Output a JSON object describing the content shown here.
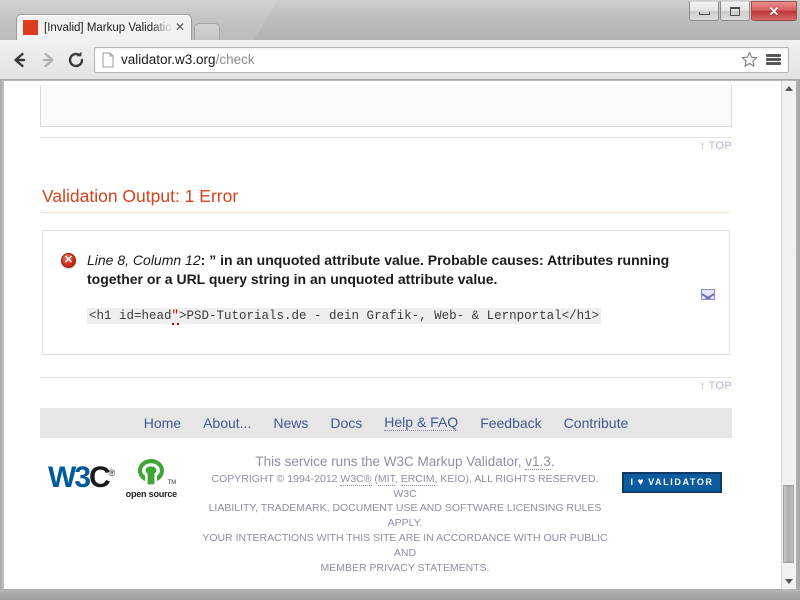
{
  "window": {
    "minimize_label": "Minimize",
    "maximize_label": "Maximize",
    "close_label": "✕"
  },
  "tab": {
    "title": "[Invalid] Markup Validatio",
    "close_label": "✕",
    "favicon_color": "#dd3b1f"
  },
  "toolbar": {
    "back_label": "Back",
    "forward_label": "Forward",
    "reload_label": "Reload",
    "bookmark_label": "Bookmark this page",
    "menu_label": "Customize and control"
  },
  "omnibox": {
    "host": "validator.w3.org",
    "path": "/check",
    "full_url": "validator.w3.org/check"
  },
  "page": {
    "top_links": [
      {
        "arrow": "↑",
        "label": "TOP"
      },
      {
        "arrow": "↑",
        "label": "TOP"
      }
    ],
    "validation_heading": "Validation Output: 1 Error",
    "error": {
      "location": "Line 8, Column 12",
      "separator": ": ",
      "message": "” in an unquoted attribute value. Probable causes: Attributes running together or a URL query string in an unquoted attribute value.",
      "code_before": "<h1 id=head",
      "code_badchar": "\"",
      "code_after": ">PSD-Tutorials.de - dein Grafik-, Web- & Lernportal</h1>",
      "code_full": "<h1 id=head\">PSD-Tutorials.de - dein Grafik-, Web- & Lernportal</h1>",
      "icon_title": "error",
      "icon_glyph": "✕"
    },
    "footer_nav": [
      {
        "label": "Home",
        "dotted": false
      },
      {
        "label": "About...",
        "dotted": false
      },
      {
        "label": "News",
        "dotted": false
      },
      {
        "label": "Docs",
        "dotted": false
      },
      {
        "label": "Help & FAQ",
        "dotted": true
      },
      {
        "label": "Feedback",
        "dotted": false
      },
      {
        "label": "Contribute",
        "dotted": false
      }
    ],
    "footer": {
      "w3c_logo_w3": "W3",
      "w3c_logo_c": "C",
      "w3c_logo_reg": "®",
      "osi_text": "open source",
      "osi_tm": "TM",
      "service_line_pre": "This service runs the W3C Markup Validator, ",
      "service_version": "v1.3",
      "service_line_post": ".",
      "copyright_line1_a": "COPYRIGHT © 1994-2012 ",
      "copyright_w3c": "W3C®",
      "copyright_line1_b": " (",
      "copyright_mit": "MIT",
      "copyright_sep1": ", ",
      "copyright_ercim": "ERCIM",
      "copyright_sep2": ", ",
      "copyright_keio": "KEIO",
      "copyright_line1_c": "), ALL RIGHTS RESERVED. W3C",
      "copyright_line2": "LIABILITY, TRADEMARK, DOCUMENT USE AND SOFTWARE LICENSING RULES APPLY.",
      "copyright_line3": "YOUR INTERACTIONS WITH THIS SITE ARE IN ACCORDANCE WITH OUR PUBLIC AND",
      "copyright_line4": "MEMBER PRIVACY STATEMENTS.",
      "badge_pre": "I",
      "badge_heart": "♥",
      "badge_text": "VALIDATOR"
    }
  },
  "colors": {
    "heading": "#d4431c",
    "link": "#3e5a8e",
    "top_link": "#b3b0cf",
    "error_red": "#cc0000",
    "badge_bg": "#0b5b9e",
    "w3c_blue": "#005a9c",
    "osi_green": "#3fa535",
    "footer_text": "#8f8da8"
  }
}
